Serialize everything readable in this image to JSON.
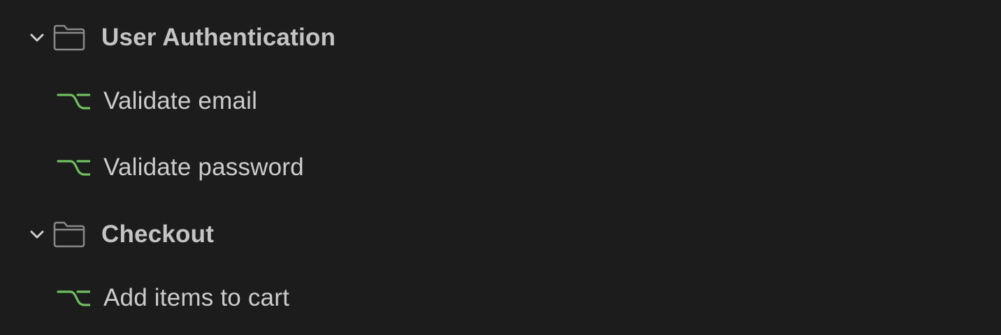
{
  "colors": {
    "background": "#1c1c1c",
    "text": "#cccccc",
    "icon_gray": "#8a8a8a",
    "branch_green": "#6fbf5f"
  },
  "tree": {
    "groups": [
      {
        "label": "User Authentication",
        "expanded": true,
        "icon": "folder-icon",
        "items": [
          {
            "label": "Validate email",
            "icon": "branch-icon"
          },
          {
            "label": "Validate password",
            "icon": "branch-icon"
          }
        ]
      },
      {
        "label": "Checkout",
        "expanded": true,
        "icon": "folder-icon",
        "items": [
          {
            "label": "Add items to cart",
            "icon": "branch-icon"
          }
        ]
      }
    ]
  }
}
